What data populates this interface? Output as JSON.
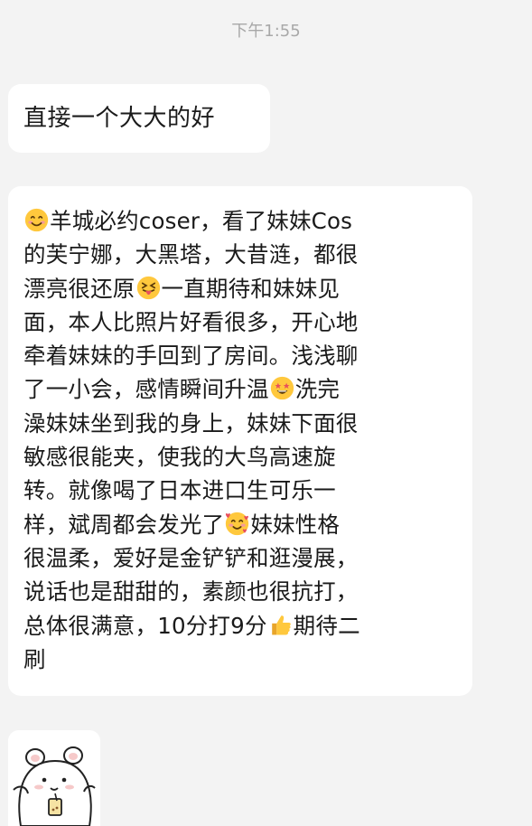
{
  "timestamp": "下午1:55",
  "messages": [
    {
      "lines": [
        [
          "直接一个大大的好"
        ]
      ]
    },
    {
      "lines": [
        [
          {
            "emoji": "smiling-face-icon"
          },
          "羊城必约coser，看了妹妹Cos"
        ],
        [
          "的芙宁娜，大黑塔，大昔涟，都很"
        ],
        [
          "漂亮很还原",
          {
            "emoji": "squinting-tongue-face-icon"
          },
          "一直期待和妹妹见"
        ],
        [
          "面，本人比照片好看很多，开心地"
        ],
        [
          "牵着妹妹的手回到了房间。浅浅聊"
        ],
        [
          "了一小会，感情瞬间升温",
          {
            "emoji": "star-struck-face-icon"
          },
          "洗完"
        ],
        [
          "澡妹妹坐到我的身上，妹妹下面很"
        ],
        [
          "敏感很能夹，使我的大鸟高速旋"
        ],
        [
          "转。就像喝了日本进口生可乐一"
        ],
        [
          "样，斌周都会发光了",
          {
            "emoji": "smiling-face-with-hearts-icon"
          },
          "妹妹性格"
        ],
        [
          "很温柔，爱好是金铲铲和逛漫展，"
        ],
        [
          "说话也是甜甜的，素颜也很抗打，"
        ],
        [
          "总体很满意，10分打9分",
          {
            "emoji": "thumbs-up-icon"
          },
          "期待二"
        ],
        [
          "刷"
        ]
      ]
    }
  ],
  "colors": {
    "background": "#f3f3f3",
    "bubble": "#ffffff",
    "text": "#1a1a1a",
    "timestamp": "#a8a8a8",
    "emoji_face": "#ffc83d"
  }
}
